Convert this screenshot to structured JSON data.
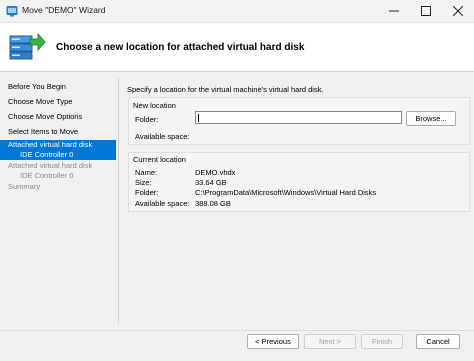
{
  "window": {
    "title": "Move \"DEMO\" Wizard"
  },
  "header": {
    "heading": "Choose a new location for attached virtual hard disk"
  },
  "nav": {
    "items": [
      {
        "label": "Before You Begin",
        "sub": "",
        "state": "normal"
      },
      {
        "label": "Choose Move Type",
        "sub": "",
        "state": "normal"
      },
      {
        "label": "Choose Move Options",
        "sub": "",
        "state": "normal"
      },
      {
        "label": "Select Items to Move",
        "sub": "",
        "state": "normal"
      },
      {
        "label": "Attached virtual hard disk",
        "sub": "IDE Controller 0",
        "state": "active"
      },
      {
        "label": "Attached virtual hard disk",
        "sub": "IDE Controller 0",
        "state": "disabled"
      },
      {
        "label": "Summary",
        "sub": "",
        "state": "disabled"
      }
    ]
  },
  "content": {
    "instruction": "Specify a location for the virtual machine's virtual hard disk.",
    "new_location": {
      "title": "New location",
      "folder_label": "Folder:",
      "folder_value": "",
      "browse_label": "Browse...",
      "available_space_label": "Available space:"
    },
    "current_location": {
      "title": "Current location",
      "rows": [
        {
          "label": "Name:",
          "value": "DEMO.vhdx"
        },
        {
          "label": "Size:",
          "value": "33.64 GB"
        },
        {
          "label": "Folder:",
          "value": "C:\\ProgramData\\Microsoft\\Windows\\Virtual Hard Disks"
        },
        {
          "label": "Available space:",
          "value": "388.08 GB"
        }
      ]
    }
  },
  "footer": {
    "previous_label": "< Previous",
    "next_label": "Next >",
    "finish_label": "Finish",
    "cancel_label": "Cancel"
  },
  "colors": {
    "accent": "#0078d7",
    "window_bg": "#f0f0f0",
    "header_bg": "#ffffff"
  },
  "icons": [
    "hyper-v-app-icon",
    "minimize-icon",
    "maximize-icon",
    "close-icon",
    "server-move-icon"
  ]
}
